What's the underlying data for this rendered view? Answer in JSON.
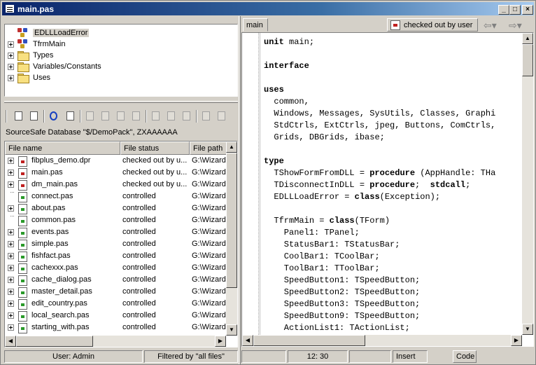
{
  "window": {
    "title": "main.pas"
  },
  "tree": {
    "items": [
      {
        "label": "EDLLLoadError",
        "icon": "class-icon"
      },
      {
        "label": "TfrmMain",
        "icon": "class-icon"
      },
      {
        "label": "Types",
        "icon": "folder-icon"
      },
      {
        "label": "Variables/Constants",
        "icon": "folder-icon"
      },
      {
        "label": "Uses",
        "icon": "folder-icon"
      }
    ]
  },
  "database_path": "SourceSafe Database \"$/DemoPack\", ZXAAAAAA",
  "file_list": {
    "columns": [
      "File name",
      "File status",
      "File path"
    ],
    "rows": [
      {
        "name": "fibplus_demo.dpr",
        "status": "checked out by u...",
        "path": "G:\\Wizard",
        "status_color": "red"
      },
      {
        "name": "main.pas",
        "status": "checked out by u...",
        "path": "G:\\Wizard",
        "status_color": "red"
      },
      {
        "name": "dm_main.pas",
        "status": "checked out by u...",
        "path": "G:\\Wizard",
        "status_color": "red"
      },
      {
        "name": "connect.pas",
        "status": "controlled",
        "path": "G:\\Wizard",
        "status_color": "green"
      },
      {
        "name": "about.pas",
        "status": "controlled",
        "path": "G:\\Wizard",
        "status_color": "green"
      },
      {
        "name": "common.pas",
        "status": "controlled",
        "path": "G:\\Wizard",
        "status_color": "green"
      },
      {
        "name": "events.pas",
        "status": "controlled",
        "path": "G:\\Wizard",
        "status_color": "green"
      },
      {
        "name": "simple.pas",
        "status": "controlled",
        "path": "G:\\Wizard",
        "status_color": "green"
      },
      {
        "name": "fishfact.pas",
        "status": "controlled",
        "path": "G:\\Wizard",
        "status_color": "green"
      },
      {
        "name": "cachexxx.pas",
        "status": "controlled",
        "path": "G:\\Wizard",
        "status_color": "green"
      },
      {
        "name": "cache_dialog.pas",
        "status": "controlled",
        "path": "G:\\Wizard",
        "status_color": "green"
      },
      {
        "name": "master_detail.pas",
        "status": "controlled",
        "path": "G:\\Wizard",
        "status_color": "green"
      },
      {
        "name": "edit_country.pas",
        "status": "controlled",
        "path": "G:\\Wizard",
        "status_color": "green"
      },
      {
        "name": "local_search.pas",
        "status": "controlled",
        "path": "G:\\Wizard",
        "status_color": "green"
      },
      {
        "name": "starting_with.pas",
        "status": "controlled",
        "path": "G:\\Wizard",
        "status_color": "green"
      }
    ]
  },
  "left_status": {
    "user": "User: Admin",
    "filter": "Filtered by \"all files\""
  },
  "editor": {
    "tab_label": "main",
    "checkout_status": "checked out by user",
    "code_lines": [
      "unit main;",
      "",
      "interface",
      "",
      "uses",
      "  common,",
      "  Windows, Messages, SysUtils, Classes, Graphi",
      "  StdCtrls, ExtCtrls, jpeg, Buttons, ComCtrls,",
      "  Grids, DBGrids, ibase;",
      "",
      "type",
      "  TShowFormFromDLL = procedure (AppHandle: THa",
      "  TDisconnectInDLL = procedure;  stdcall;",
      "  EDLLLoadError = class(Exception);",
      "",
      "  TfrmMain = class(TForm)",
      "    Panel1: TPanel;",
      "    StatusBar1: TStatusBar;",
      "    CoolBar1: TCoolBar;",
      "    ToolBar1: TToolBar;",
      "    SpeedButton1: TSpeedButton;",
      "    SpeedButton2: TSpeedButton;",
      "    SpeedButton3: TSpeedButton;",
      "    SpeedButton9: TSpeedButton;",
      "    ActionList1: TActionList;"
    ],
    "keywords": [
      "unit",
      "interface",
      "uses",
      "type",
      "procedure",
      "stdcall",
      "class"
    ]
  },
  "editor_status": {
    "position": "12: 30",
    "mode": "Insert",
    "view_tab": "Code"
  },
  "colors": {
    "titlebar_start": "#0a246a",
    "titlebar_end": "#a6caf0",
    "face": "#d4d0c8",
    "checked_out": "#c02020",
    "controlled": "#2a9a2a"
  }
}
